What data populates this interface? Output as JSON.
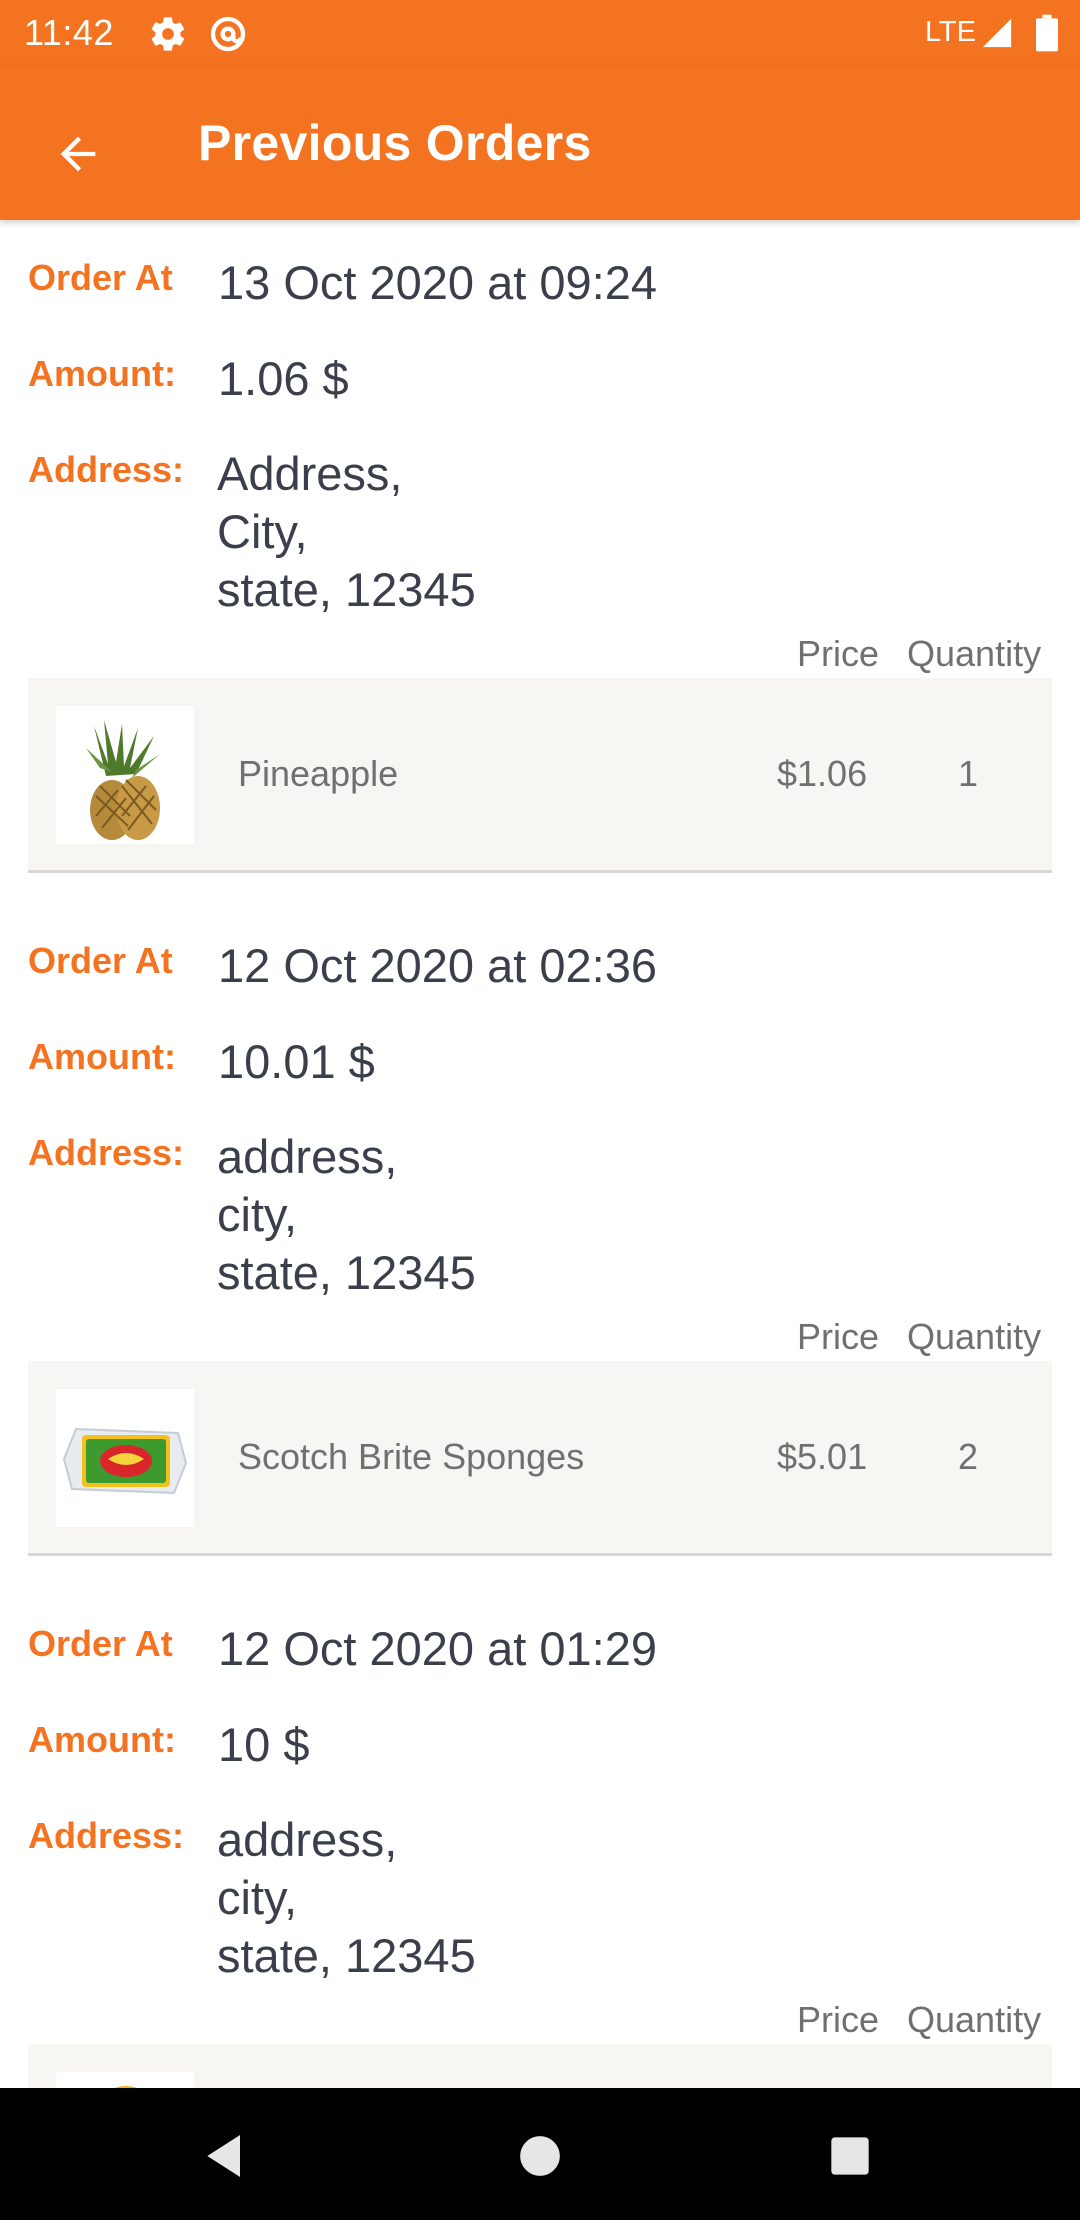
{
  "status_bar": {
    "time": "11:42",
    "network": "LTE",
    "icons": [
      "settings-icon",
      "at-sign-icon",
      "signal-icon",
      "battery-icon"
    ]
  },
  "app_bar": {
    "title": "Previous Orders",
    "back_icon": "arrow-left-icon",
    "color": "#F37321"
  },
  "labels": {
    "order_at": "Order At",
    "amount": "Amount:",
    "address": "Address:",
    "price_header": "Price",
    "quantity_header": "Quantity"
  },
  "orders": [
    {
      "order_at": "13 Oct 2020 at 09:24",
      "amount": "1.06 $",
      "address": [
        "Address,",
        "City,",
        "state, 12345"
      ],
      "items": [
        {
          "name": "Pineapple",
          "price": "$1.06",
          "quantity": "1",
          "image": "pineapple"
        }
      ]
    },
    {
      "order_at": "12 Oct 2020 at 02:36",
      "amount": "10.01 $",
      "address": [
        "address,",
        "city,",
        "state, 12345"
      ],
      "items": [
        {
          "name": "Scotch Brite Sponges",
          "price": "$5.01",
          "quantity": "2",
          "image": "sponges"
        }
      ]
    },
    {
      "order_at": "12 Oct 2020 at 01:29",
      "amount": "10 $",
      "address": [
        "address,",
        "city,",
        "state, 12345"
      ],
      "items": []
    }
  ],
  "nav_bar": {
    "icons": [
      "back-triangle-icon",
      "home-circle-icon",
      "recents-square-icon"
    ]
  },
  "colors": {
    "accent": "#F37321",
    "value_text": "#3a3f4b",
    "secondary_text": "#707070",
    "card_bg": "#f8f6f3"
  }
}
